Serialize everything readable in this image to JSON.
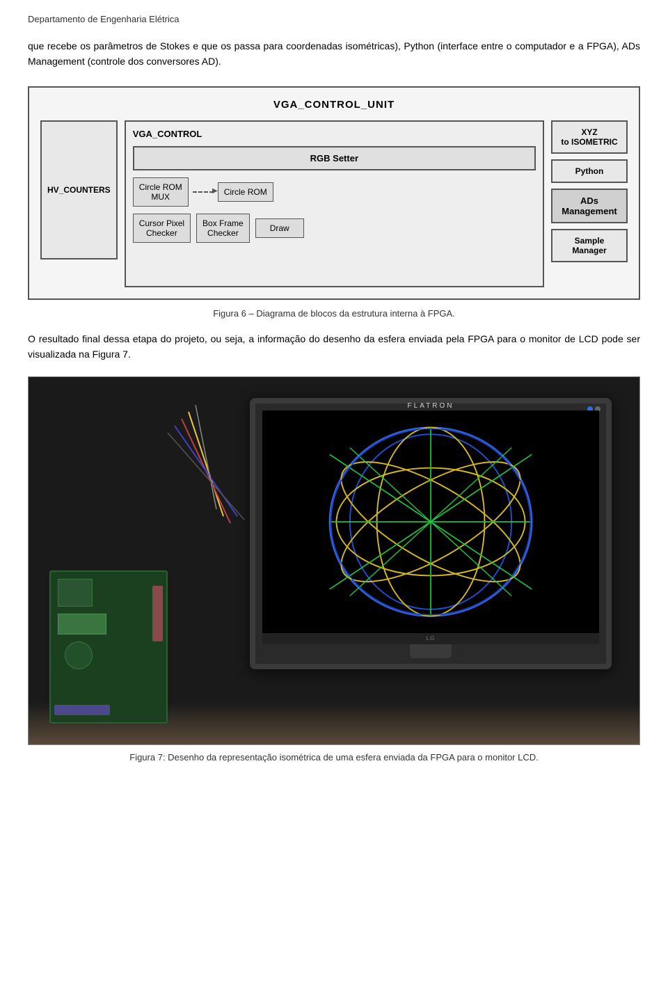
{
  "header": {
    "title": "Departamento de Engenharia Elétrica"
  },
  "intro": {
    "text": "que recebe os parâmetros de Stokes e que os passa para coordenadas isométricas), Python (interface entre o computador e a FPGA), ADs Management (controle dos conversores AD)."
  },
  "diagram": {
    "title": "VGA_CONTROL_UNIT",
    "vga_control_label": "VGA_CONTROL",
    "hv_counters_label": "HV_COUNTERS",
    "rgb_setter_label": "RGB Setter",
    "circle_rom_mux_label": "Circle ROM\nMUX",
    "circle_rom_label": "Circle ROM",
    "cursor_pixel_checker_label": "Cursor Pixel\nChecker",
    "box_frame_checker_label": "Box Frame\nChecker",
    "draw_label": "Draw",
    "xyz_isometric_label": "XYZ\nto ISOMETRIC",
    "python_label": "Python",
    "ads_management_label": "ADs\nManagement",
    "sample_manager_label": "Sample\nManager"
  },
  "figure6_caption": "Figura 6 – Diagrama de blocos da estrutura interna à FPGA.",
  "result_text": "O resultado final dessa etapa do projeto, ou seja, a informação do desenho da esfera enviada pela FPGA para o monitor de LCD pode ser visualizada na Figura 7.",
  "monitor_brand": "FLATRON",
  "figure7_caption": "Figura 7: Desenho da representação isométrica de uma esfera enviada da FPGA para o monitor LCD."
}
